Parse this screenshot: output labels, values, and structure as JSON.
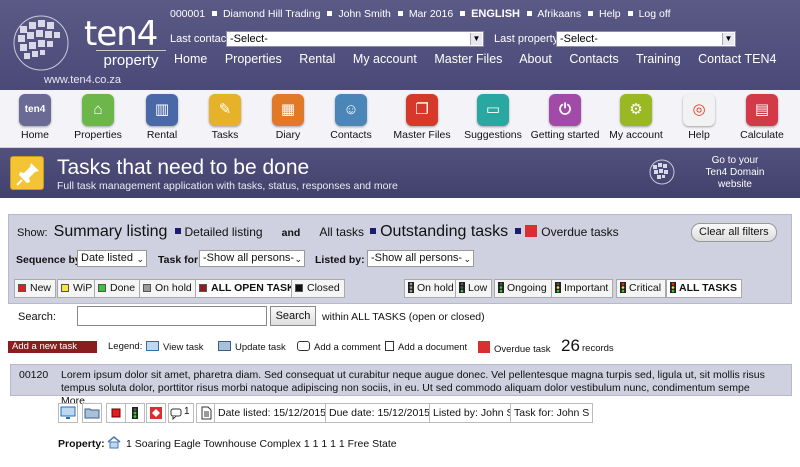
{
  "header": {
    "brand": "ten4",
    "brand_sub": "property",
    "url": "www.ten4.co.za",
    "agency_code": "000001",
    "agency": "Diamond Hill Trading",
    "user": "John Smith",
    "date": "Mar 2016",
    "lang_active": "ENGLISH",
    "lang_other": "Afrikaans",
    "help": "Help",
    "logoff": "Log off",
    "last_contact_label": "Last contact:",
    "last_contact_value": "-Select-",
    "last_property_label": "Last property:",
    "last_property_value": "-Select-",
    "nav": [
      "Home",
      "Properties",
      "Rental",
      "My account",
      "Master Files",
      "About",
      "Contacts",
      "Training",
      "Contact TEN4"
    ]
  },
  "iconbar": [
    {
      "label": "Home",
      "icon": "ten4-home-icon",
      "color": "#6a6a94"
    },
    {
      "label": "Properties",
      "icon": "house-icon",
      "color": "#6cb64a"
    },
    {
      "label": "Rental",
      "icon": "buildings-icon",
      "color": "#4a68a8"
    },
    {
      "label": "Tasks",
      "icon": "pin-icon",
      "color": "#e6b22a"
    },
    {
      "label": "Diary",
      "icon": "calendar-icon",
      "color": "#e07a26"
    },
    {
      "label": "Contacts",
      "icon": "person-icon",
      "color": "#4a86b8"
    },
    {
      "label": "Master Files",
      "icon": "folders-icon",
      "color": "#d6382a"
    },
    {
      "label": "Suggestions",
      "icon": "chat-icon",
      "color": "#28a8a0"
    },
    {
      "label": "Getting started",
      "icon": "power-icon",
      "color": "#a24aa8"
    },
    {
      "label": "My account",
      "icon": "gear-icon",
      "color": "#9ab822"
    },
    {
      "label": "Help",
      "icon": "lifebuoy-icon",
      "color": "#e8e8e8"
    },
    {
      "label": "Calculate",
      "icon": "calculator-icon",
      "color": "#d23a4a"
    }
  ],
  "banner": {
    "title": "Tasks that need to be done",
    "subtitle": "Full task management application with tasks, status, responses and more",
    "domain_line1": "Go to your",
    "domain_line2": "Ten4 Domain",
    "domain_line3": "website"
  },
  "filters": {
    "show_label": "Show:",
    "summary": "Summary listing",
    "detailed": "Detailed listing",
    "and": "and",
    "all_tasks": "All tasks",
    "outstanding": "Outstanding tasks",
    "overdue": "Overdue tasks",
    "clear": "Clear all filters",
    "sequence_label": "Sequence by:",
    "sequence_value": "Date listed",
    "taskfor_label": "Task for:",
    "taskfor_value": "-Show all persons-",
    "listedby_label": "Listed by:",
    "listedby_value": "-Show all persons-"
  },
  "status_chips": [
    {
      "label": "New",
      "color": "#e02020"
    },
    {
      "label": "WiP",
      "color": "#f5e642"
    },
    {
      "label": "Done",
      "color": "#3fbf3f"
    },
    {
      "label": "On hold",
      "color": "#9a9a9a"
    },
    {
      "label": "ALL OPEN TASKS",
      "color": "#8a1e1e"
    },
    {
      "label": "Closed",
      "color": "#111111"
    }
  ],
  "priority_chips": [
    {
      "label": "On hold"
    },
    {
      "label": "Low"
    },
    {
      "label": "Ongoing"
    },
    {
      "label": "Important"
    },
    {
      "label": "Critical"
    },
    {
      "label": "ALL TASKS"
    }
  ],
  "search": {
    "label": "Search:",
    "value": "",
    "button": "Search",
    "note": "within ALL TASKS (open or closed)"
  },
  "legend": {
    "add_task": "Add a new task",
    "legend_label": "Legend:",
    "view": "View task",
    "update": "Update task",
    "comment": "Add a comment",
    "document": "Add a document",
    "overdue": "Overdue task",
    "count": "26",
    "records": "records"
  },
  "task": {
    "id": "00120",
    "description": "Lorem ipsum dolor sit amet, pharetra diam. Sed consequat ut curabitur neque augue donec. Vel pellentesque magna turpis sed, ligula ut, sit mollis risus tempus soluta dolor, porttitor risus morbi natoque adipiscing non sociis, in eu. Ut sed commodo aliquam dolor vestibulum nunc, condimentum sempe More...",
    "comment_count": "1",
    "date_listed": "Date listed: 15/12/2015",
    "due_date": "Due date: 15/12/2015",
    "listed_by": "Listed by: John S",
    "task_for": "Task for: John S",
    "property_label": "Property:",
    "property": "1 Soaring Eagle Townhouse Complex 1 1 1 1 1 Free State"
  }
}
